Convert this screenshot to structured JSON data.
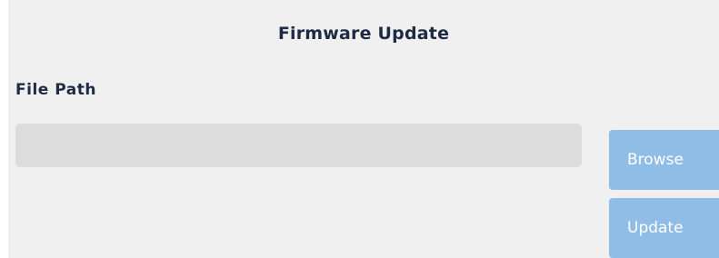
{
  "dialog": {
    "title": "Firmware Update",
    "file_path_label": "File Path",
    "file_path_value": "",
    "file_path_placeholder": ""
  },
  "buttons": {
    "browse_label": "Browse",
    "update_label": "Update"
  },
  "colors": {
    "panel_background": "#f0f0f0",
    "input_background": "#dcdcdc",
    "button_background": "#90bde6",
    "button_text": "#ffffff",
    "text": "#1f2b44"
  }
}
